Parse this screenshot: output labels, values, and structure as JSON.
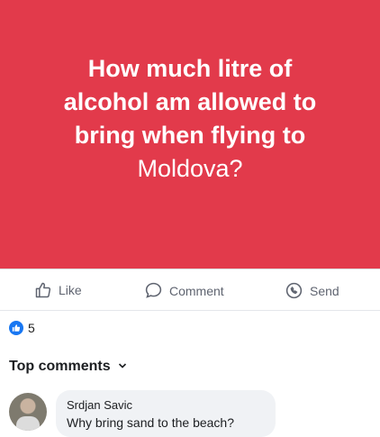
{
  "post": {
    "lines": [
      "How much litre of",
      "alcohol am allowed to",
      "bring when flying to",
      "Moldova?"
    ],
    "background_color": "#e23a4b"
  },
  "actions": {
    "like": "Like",
    "comment": "Comment",
    "send": "Send"
  },
  "reactions": {
    "count": "5"
  },
  "comments_header": {
    "label": "Top comments"
  },
  "comment": {
    "author": "Srdjan Savic",
    "text": "Why bring sand to the beach?"
  },
  "icons": [
    "like-icon",
    "comment-icon",
    "messenger-icon",
    "like-reaction-icon",
    "chevron-down-icon"
  ]
}
